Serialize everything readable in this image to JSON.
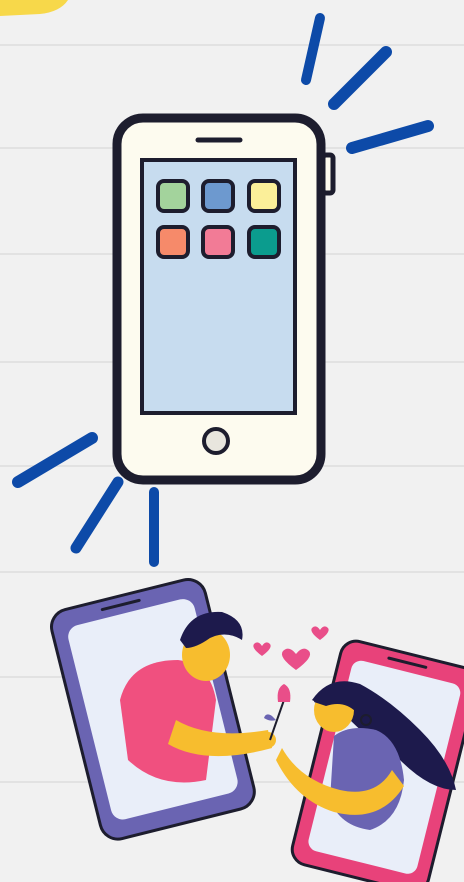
{
  "scene": {
    "description_icons": [
      "phone-icon",
      "app-icon",
      "home-button-icon",
      "heart-icon",
      "flower-icon"
    ],
    "colors": {
      "background": "#f1f1f1",
      "phone_body": "#fdfbef",
      "phone_outline": "#1d1d2e",
      "screen": "#c7dcef",
      "vibration_marks": "#0d4aa8",
      "sticky_note": "#f7d84a",
      "app_green": "#a3d39c",
      "app_blue": "#6d99cf",
      "app_yellow": "#fbef99",
      "app_orange": "#f68a6a",
      "app_pink": "#f27b96",
      "app_teal": "#0b9c8e",
      "purple_phone": "#6a64b2",
      "pink_phone": "#e8427a",
      "heart": "#e94e89"
    }
  }
}
